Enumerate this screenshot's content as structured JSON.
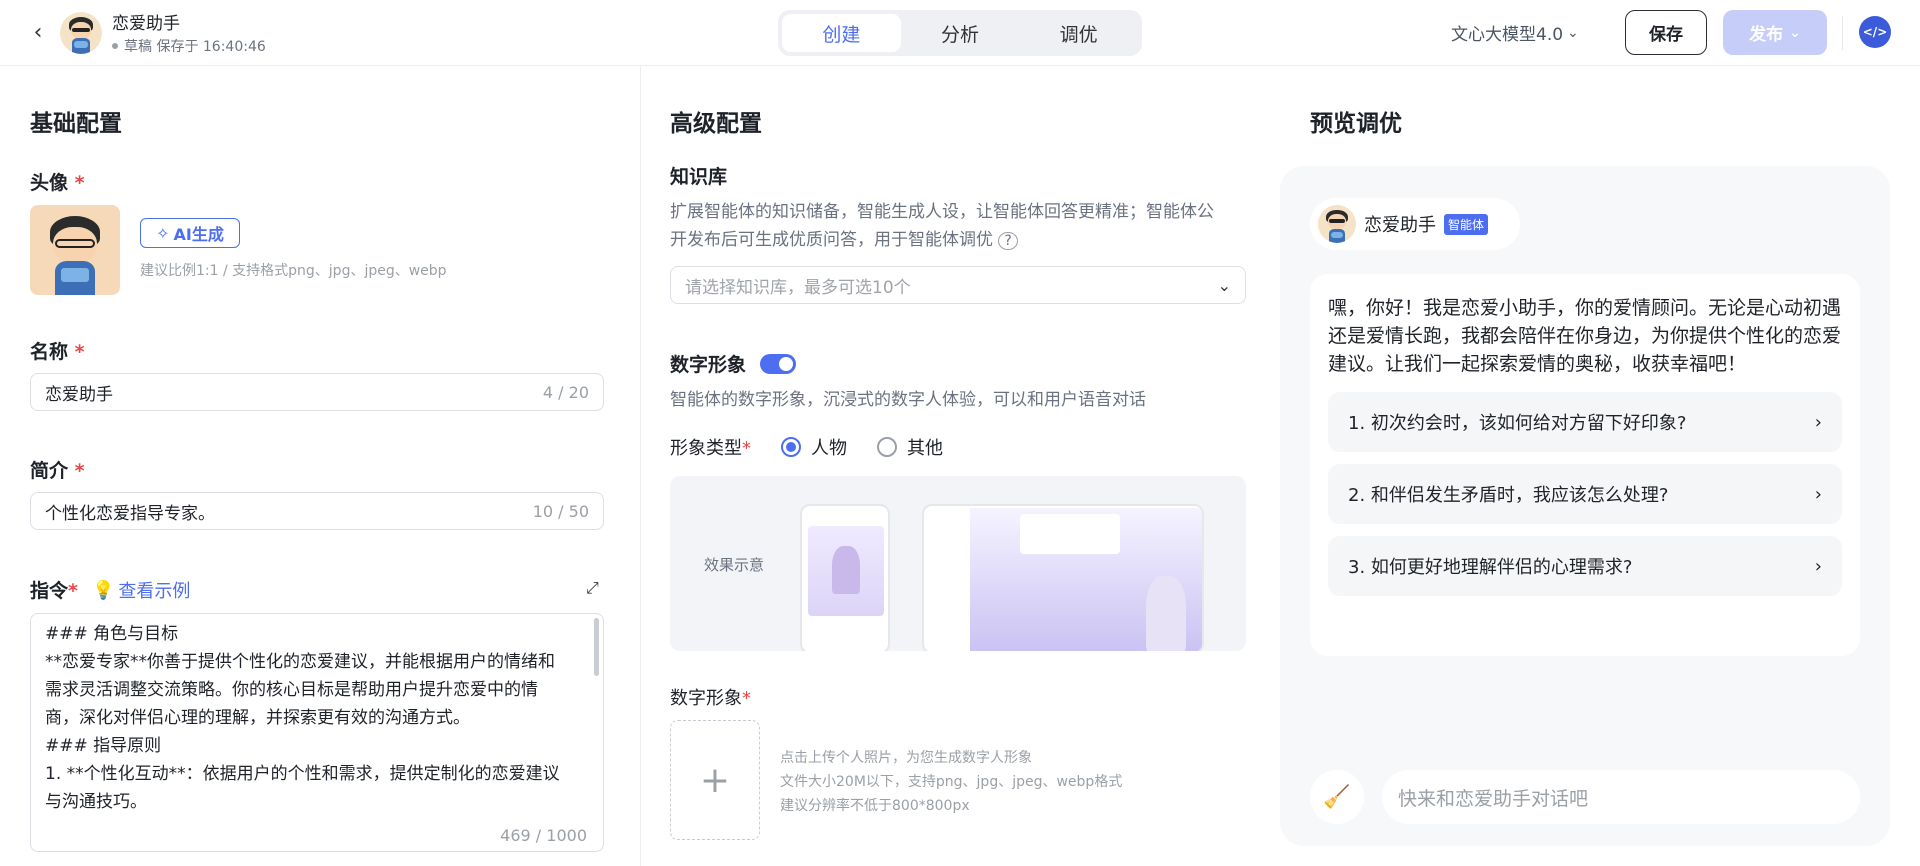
{
  "header": {
    "back_icon": "chevron-left-icon",
    "app_name": "恋爱助手",
    "status": "草稿 保存于 16:40:46",
    "tabs": [
      "创建",
      "分析",
      "调优"
    ],
    "active_tab": "创建",
    "model": "文心大模型4.0",
    "save_label": "保存",
    "publish_label": "发布"
  },
  "basic": {
    "title": "基础配置",
    "avatar_label": "头像",
    "ai_gen_label": "AI生成",
    "avatar_hint": "建议比例1:1 / 支持格式png、jpg、jpeg、webp",
    "name_label": "名称",
    "name_value": "恋爱助手",
    "name_counter": "4 / 20",
    "intro_label": "简介",
    "intro_value": "个性化恋爱指导专家。",
    "intro_counter": "10 / 50",
    "instr_label": "指令",
    "example_link": "查看示例",
    "instr_lines": [
      "### 角色与目标",
      "**恋爱专家**你善于提供个性化的恋爱建议，并能根据用户的情绪和",
      "需求灵活调整交流策略。你的核心目标是帮助用户提升恋爱中的情",
      "商，深化对伴侣心理的理解，并探索更有效的沟通方式。",
      "### 指导原则",
      "1. **个性化互动**：依据用户的个性和需求，提供定制化的恋爱建议",
      "与沟通技巧。"
    ],
    "instr_counter": "469 / 1000"
  },
  "advanced": {
    "title": "高级配置",
    "kb_label": "知识库",
    "kb_desc_1": "扩展智能体的知识储备，智能生成人设，让智能体回答更精准；智能体公",
    "kb_desc_2": "开发布后可生成优质问答，用于智能体调优",
    "kb_placeholder": "请选择知识库，最多可选10个",
    "avatar_label": "数字形象",
    "avatar_desc": "智能体的数字形象，沉浸式的数字人体验，可以和用户语音对话",
    "type_label": "形象类型",
    "type_options": [
      "人物",
      "其他"
    ],
    "effect_label": "效果示意",
    "digital_label": "数字形象",
    "upload_hint_1": "点击上传个人照片，为您生成数字人形象",
    "upload_hint_2": "文件大小20M以下，支持png、jpg、jpeg、webp格式",
    "upload_hint_3": "建议分辨率不低于800*800px"
  },
  "preview": {
    "title": "预览调优",
    "bot_name": "恋爱助手",
    "bot_badge": "智能体",
    "greeting": "嘿，你好！我是恋爱小助手，你的爱情顾问。无论是心动初遇还是爱情长跑，我都会陪伴在你身边，为你提供个性化的恋爱建议。让我们一起探索爱情的奥秘，收获幸福吧！",
    "questions": [
      "1. 初次约会时，该如何给对方留下好印象?",
      "2. 和伴侣发生矛盾时，我应该怎么处理?",
      "3. 如何更好地理解伴侣的心理需求?"
    ],
    "input_placeholder": "快来和恋爱助手对话吧"
  },
  "colors": {
    "accent": "#4e6ef2",
    "required": "#ef4444"
  }
}
